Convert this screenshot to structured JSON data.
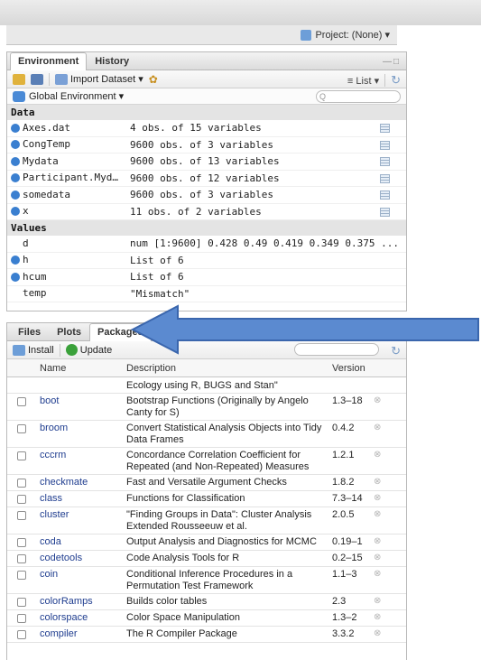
{
  "project": {
    "label": "Project: (None) ▾",
    "icon": "project-icon"
  },
  "env_pane": {
    "tabs": [
      "Environment",
      "History"
    ],
    "active_tab": "Environment",
    "toolbar": {
      "import_label": "Import Dataset ▾",
      "view_label": "≡ List ▾"
    },
    "scope_label": "Global Environment ▾",
    "search_placeholder": "Q",
    "data_title": "Data",
    "data_rows": [
      {
        "name": "Axes.dat",
        "value": "4 obs. of 15 variables"
      },
      {
        "name": "CongTemp",
        "value": "9600 obs. of 3 variables"
      },
      {
        "name": "Mydata",
        "value": "9600 obs. of 13 variables"
      },
      {
        "name": "Participant.Myd…",
        "value": "9600 obs. of 12 variables"
      },
      {
        "name": "somedata",
        "value": "9600 obs. of 3 variables"
      },
      {
        "name": "x",
        "value": "11 obs. of 2 variables"
      }
    ],
    "values_title": "Values",
    "value_rows": [
      {
        "name": "d",
        "value": "num [1:9600] 0.428 0.49 0.419 0.349 0.375 ..."
      },
      {
        "name": "h",
        "value": "List of 6"
      },
      {
        "name": "hcum",
        "value": "List of 6"
      },
      {
        "name": "temp",
        "value": "\"Mismatch\""
      }
    ]
  },
  "files_pane": {
    "tabs": [
      "Files",
      "Plots",
      "Packages"
    ],
    "active_tab": "Packages",
    "toolbar": {
      "install_label": "Install",
      "update_label": "Update"
    },
    "headers": {
      "name": "Name",
      "description": "Description",
      "version": "Version"
    },
    "continued_description": "Ecology using R, BUGS and Stan\"",
    "packages": [
      {
        "name": "boot",
        "description": "Bootstrap Functions (Originally by Angelo Canty for S)",
        "version": "1.3–18"
      },
      {
        "name": "broom",
        "description": "Convert Statistical Analysis Objects into Tidy Data Frames",
        "version": "0.4.2"
      },
      {
        "name": "cccrm",
        "description": "Concordance Correlation Coefficient for Repeated (and Non-Repeated) Measures",
        "version": "1.2.1"
      },
      {
        "name": "checkmate",
        "description": "Fast and Versatile Argument Checks",
        "version": "1.8.2"
      },
      {
        "name": "class",
        "description": "Functions for Classification",
        "version": "7.3–14"
      },
      {
        "name": "cluster",
        "description": "\"Finding Groups in Data\": Cluster Analysis Extended Rousseeuw et al.",
        "version": "2.0.5"
      },
      {
        "name": "coda",
        "description": "Output Analysis and Diagnostics for MCMC",
        "version": "0.19–1"
      },
      {
        "name": "codetools",
        "description": "Code Analysis Tools for R",
        "version": "0.2–15"
      },
      {
        "name": "coin",
        "description": "Conditional Inference Procedures in a Permutation Test Framework",
        "version": "1.1–3"
      },
      {
        "name": "colorRamps",
        "description": "Builds color tables",
        "version": "2.3"
      },
      {
        "name": "colorspace",
        "description": "Color Space Manipulation",
        "version": "1.3–2"
      },
      {
        "name": "compiler",
        "description": "The R Compiler Package",
        "version": "3.3.2"
      }
    ]
  },
  "colors": {
    "arrow_fill": "#5b8ad0",
    "arrow_stroke": "#3a66ad",
    "link": "#1f3d8f",
    "expand": "#3a7fd0"
  }
}
